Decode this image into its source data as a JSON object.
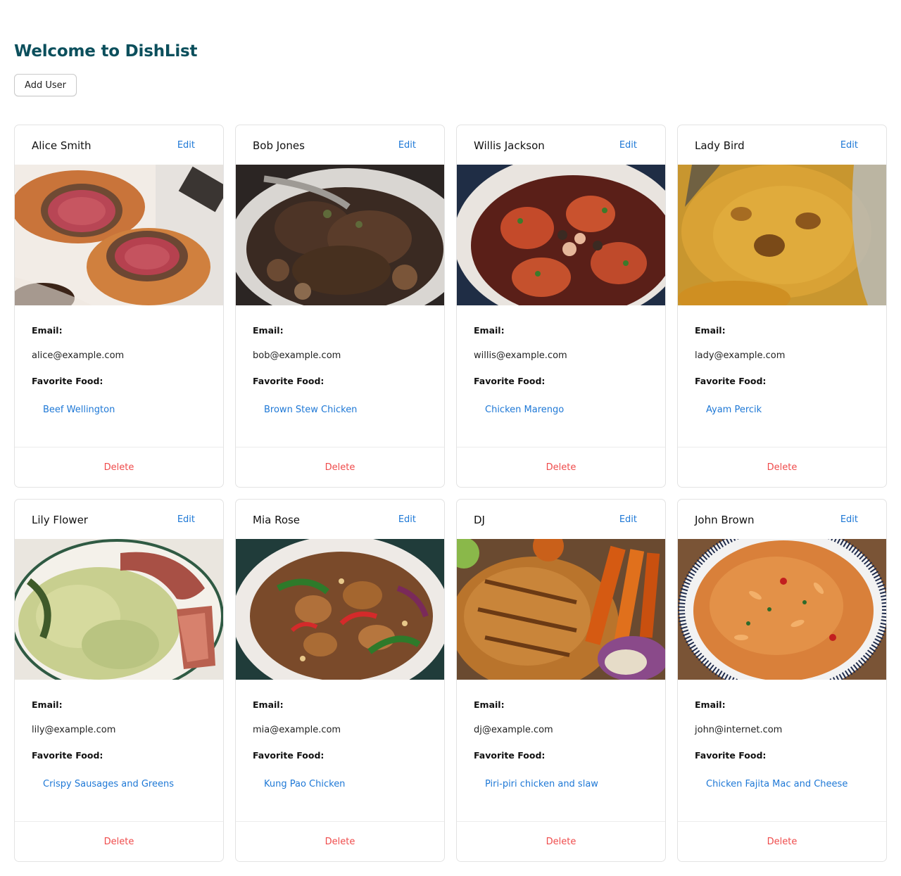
{
  "header": {
    "title": "Welcome to DishList",
    "add_user_label": "Add User"
  },
  "labels": {
    "edit": "Edit",
    "email": "Email:",
    "favorite_food": "Favorite Food:",
    "delete": "Delete"
  },
  "colors": {
    "title": "#0b4f5c",
    "link": "#1e78d6",
    "delete": "#ef4b4b"
  },
  "users": [
    {
      "name": "Alice Smith",
      "email": "alice@example.com",
      "food": "Beef Wellington",
      "image": "beef-wellington-photo"
    },
    {
      "name": "Bob Jones",
      "email": "bob@example.com",
      "food": "Brown Stew Chicken",
      "image": "brown-stew-chicken-photo"
    },
    {
      "name": "Willis Jackson",
      "email": "willis@example.com",
      "food": "Chicken Marengo",
      "image": "chicken-marengo-photo"
    },
    {
      "name": "Lady Bird",
      "email": "lady@example.com",
      "food": "Ayam Percik",
      "image": "ayam-percik-photo"
    },
    {
      "name": "Lily Flower",
      "email": "lily@example.com",
      "food": "Crispy Sausages and Greens",
      "image": "crispy-sausages-photo"
    },
    {
      "name": "Mia Rose",
      "email": "mia@example.com",
      "food": "Kung Pao Chicken",
      "image": "kung-pao-chicken-photo"
    },
    {
      "name": "DJ",
      "email": "dj@example.com",
      "food": "Piri-piri chicken and slaw",
      "image": "piri-piri-chicken-photo"
    },
    {
      "name": "John Brown",
      "email": "john@internet.com",
      "food": "Chicken Fajita Mac and Cheese",
      "image": "fajita-mac-cheese-photo"
    }
  ]
}
